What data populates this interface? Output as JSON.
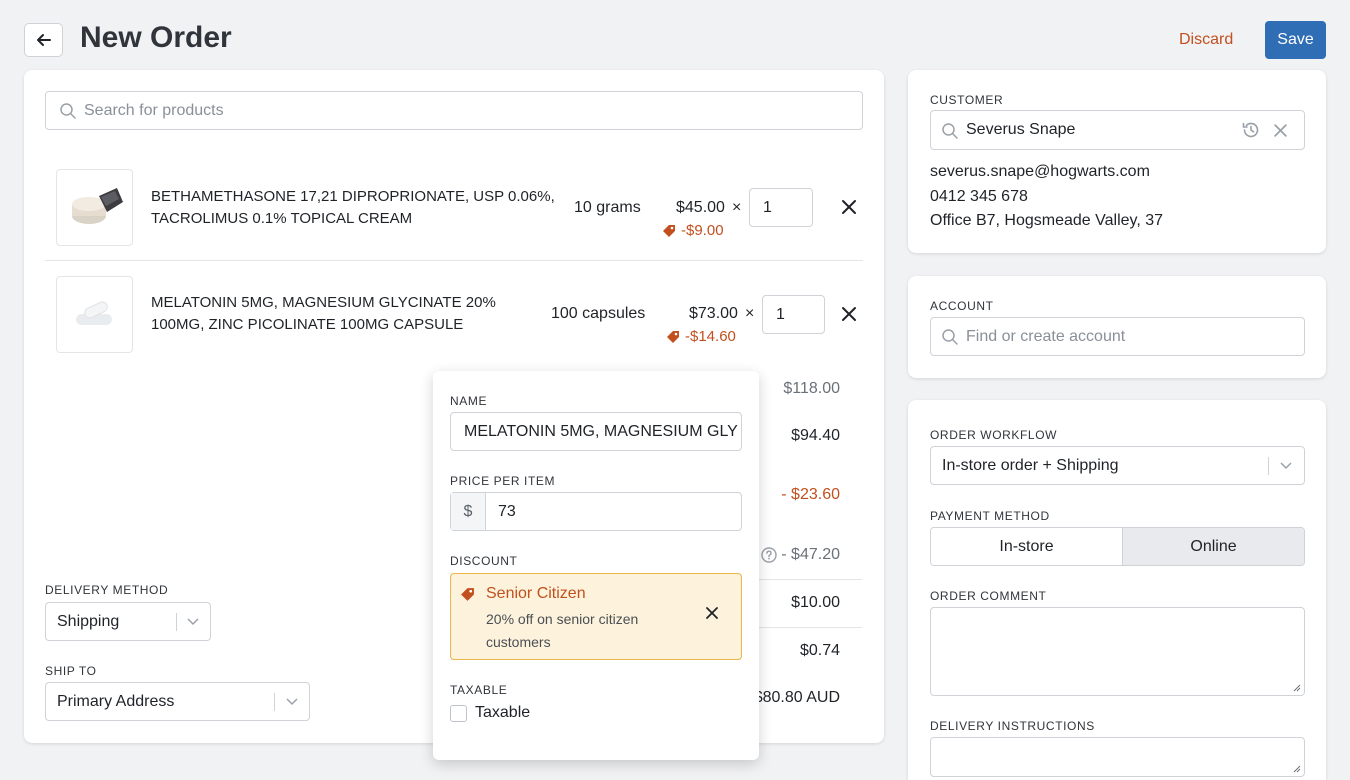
{
  "header": {
    "title": "New Order",
    "discard_label": "Discard",
    "save_label": "Save"
  },
  "search": {
    "placeholder": "Search for products"
  },
  "line_items": [
    {
      "name_line1": "BETHAMETHASONE 17,21 DIPROPRIONATE, USP 0.06%,",
      "name_line2": "TACROLIMUS 0.1% TOPICAL CREAM",
      "unit": "10 grams",
      "price": "$45.00",
      "times": "×",
      "discount": "-$9.00",
      "qty": "1"
    },
    {
      "name_line1": "MELATONIN 5MG, MAGNESIUM GLYCINATE 20%",
      "name_line2": "100MG, ZINC PICOLINATE 100MG CAPSULE",
      "unit": "100 capsules",
      "price": "$73.00",
      "times": "×",
      "discount": "-$14.60",
      "qty": "1"
    }
  ],
  "summary": {
    "subtotal": "$118.00",
    "after_discount": "$94.40",
    "discount_total": "- $23.60",
    "other_discount": "- $47.20",
    "shipping": "$10.00",
    "tax": "$0.74",
    "total": "$80.80 AUD"
  },
  "delivery": {
    "method_label": "DELIVERY METHOD",
    "method_value": "Shipping",
    "ship_to_label": "SHIP TO",
    "ship_to_value": "Primary Address"
  },
  "popover": {
    "name_label": "NAME",
    "name_value": "MELATONIN 5MG, MAGNESIUM GLY",
    "price_label": "PRICE PER ITEM",
    "currency": "$",
    "price_value": "73",
    "discount_label": "DISCOUNT",
    "discount_title": "Senior Citizen",
    "discount_desc_line1": "20% off on senior citizen",
    "discount_desc_line2": "customers",
    "taxable_label": "TAXABLE",
    "taxable_checkbox": "Taxable"
  },
  "customer": {
    "label": "CUSTOMER",
    "name": "Severus Snape",
    "email": "severus.snape@hogwarts.com",
    "phone": "0412 345 678",
    "address": "Office B7, Hogsmeade Valley, 37"
  },
  "account": {
    "label": "ACCOUNT",
    "placeholder": "Find or create account"
  },
  "order": {
    "workflow_label": "ORDER WORKFLOW",
    "workflow_value": "In-store order + Shipping",
    "payment_label": "PAYMENT METHOD",
    "payment_options": [
      "In-store",
      "Online"
    ],
    "payment_selected": "Online",
    "comment_label": "ORDER COMMENT",
    "instructions_label": "DELIVERY INSTRUCTIONS"
  },
  "colors": {
    "accent": "#2f6db5",
    "danger": "#c2501f",
    "discount_bg": "#fdf3dc",
    "discount_border": "#e8b64a"
  }
}
